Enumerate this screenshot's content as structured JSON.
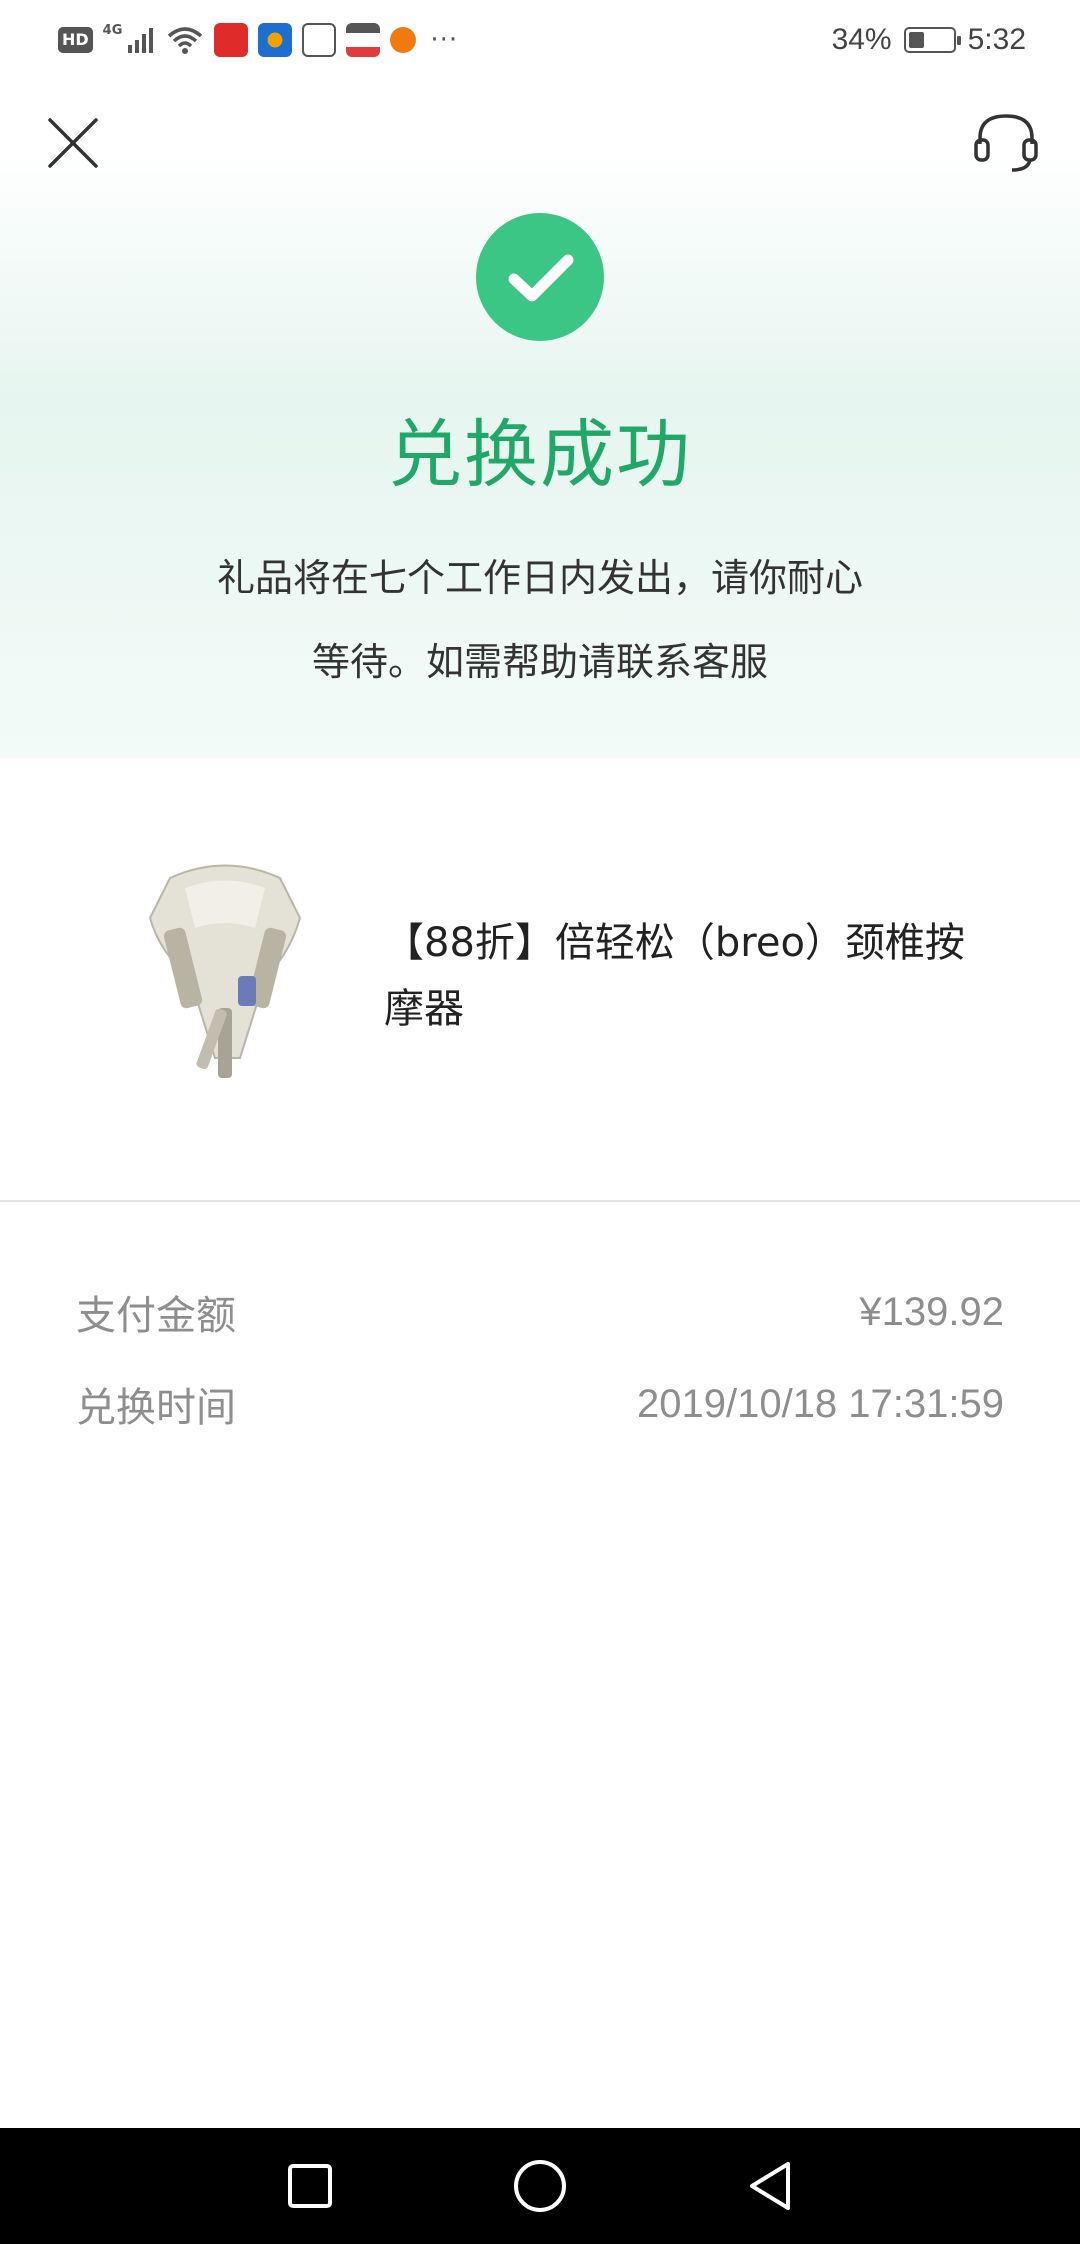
{
  "status_bar": {
    "hd_badge": "HD",
    "network": "4G",
    "battery_text": "34%",
    "battery_level": 0.34,
    "time": "5:32",
    "more": "···"
  },
  "header": {
    "title": "兑换成功",
    "subtitle": "礼品将在七个工作日内发出，请你耐心等待。如需帮助请联系客服"
  },
  "product": {
    "name": "【88折】倍轻松（breo）颈椎按摩器"
  },
  "order_info": {
    "amount_label": "支付金额",
    "amount_value": "¥139.92",
    "time_label": "兑换时间",
    "time_value": "2019/10/18 17:31:59"
  },
  "colors": {
    "accent_green": "#3cc686",
    "title_green": "#21a868"
  }
}
